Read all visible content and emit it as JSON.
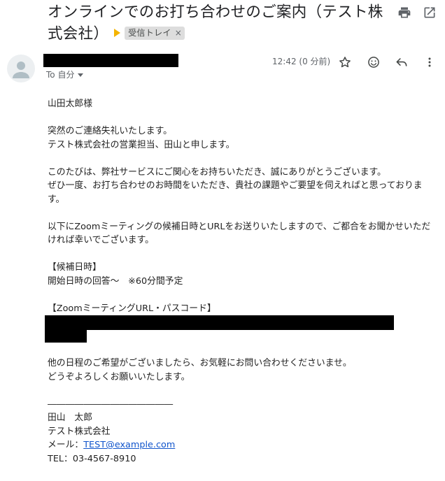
{
  "subject": {
    "title": "オンラインでのお打ち合わせのご案内（テスト株式会社）",
    "label": "受信トレイ",
    "label_remove": "×"
  },
  "toolbar": {
    "print_icon": "print-icon",
    "open_new_window_icon": "open-in-new-window-icon"
  },
  "message_header": {
    "to_label": "To 自分",
    "timestamp": "12:42 (0 分前)",
    "icons": [
      "star-icon",
      "emoji-icon",
      "reply-icon",
      "more-vert-icon"
    ]
  },
  "body": {
    "greeting": "山田太郎様",
    "intro_1": "突然のご連絡失礼いたします。",
    "intro_2": "テスト株式会社の営業担当、田山と申します。",
    "para2_1": "このたびは、弊社サービスにご関心をお持ちいただき、誠にありがとうございます。",
    "para2_2": "ぜひ一度、お打ち合わせのお時間をいただき、貴社の課題やご要望を伺えればと思っております。",
    "para3": "以下にZoomミーティングの候補日時とURLをお送りいたしますので、ご都合をお聞かせいただければ幸いでございます。",
    "candidate_heading": "【候補日時】",
    "candidate_value": "開始日時の回答〜　※60分間予定",
    "zoom_heading": "【ZoomミーティングURL・パスコード】",
    "closing_1": "他の日程のご希望がございましたら、お気軽にお問い合わせくださいませ。",
    "closing_2": "どうぞよろしくお願いいたします。"
  },
  "signature": {
    "divider": "――――――――――――――",
    "name": "田山　太郎",
    "company": "テスト株式会社",
    "mail_label": "メール：",
    "email": "TEST@example.com",
    "tel": "TEL：03-4567-8910"
  },
  "colors": {
    "label_marker": "#f4b400",
    "link": "#1155cc",
    "redaction": "#000000"
  }
}
